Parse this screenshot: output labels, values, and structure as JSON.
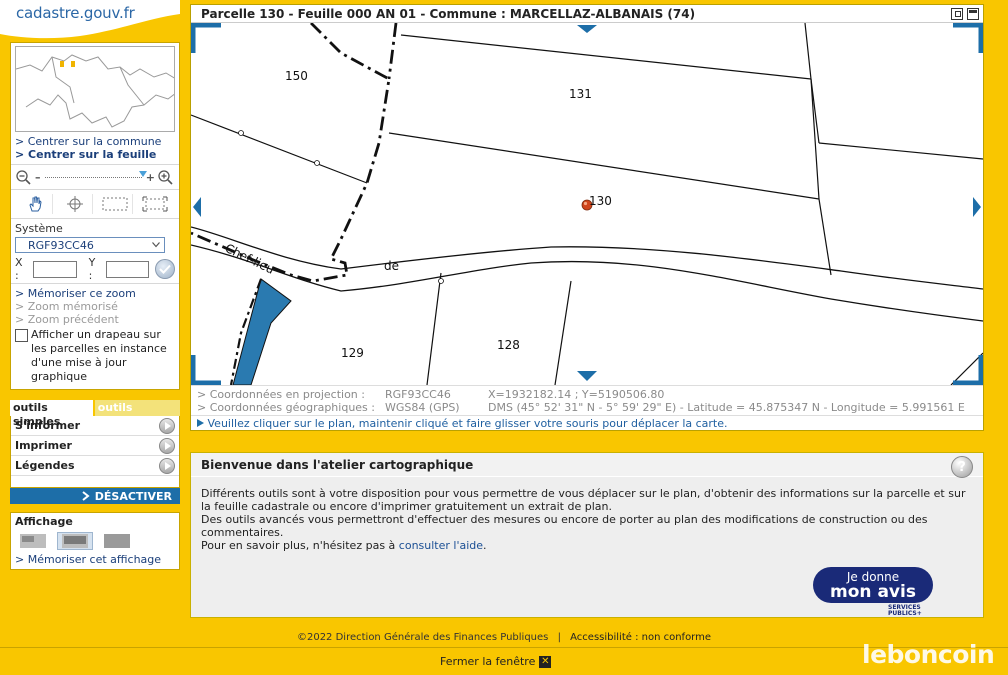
{
  "logo": {
    "text": "cadastre.gouv.fr"
  },
  "left": {
    "center_commune": "Centrer sur la commune",
    "center_feuille": "Centrer sur la feuille",
    "systeme_label": "Système",
    "systeme_value": "RGF93CC46",
    "x_label": "X :",
    "y_label": "Y :",
    "memoriser_zoom": "Mémoriser ce zoom",
    "zoom_memorise": "Zoom mémorisé",
    "zoom_precedent": "Zoom précédent",
    "flag_text": "Afficher un drapeau sur les parcelles en instance d'une mise à jour graphique",
    "tab_simple": "outils simples",
    "tab_advanced": "outils avancés",
    "tools": [
      "S'informer",
      "Imprimer",
      "Légendes"
    ],
    "deactivate": "DÉSACTIVER",
    "affichage_title": "Affichage",
    "memoriser_affichage": "Mémoriser cet affichage"
  },
  "map": {
    "title": "Parcelle 130 - Feuille 000 AN 01 - Commune : MARCELLAZ-ALBANAIS (74)",
    "parcels": [
      "150",
      "131",
      "130",
      "129",
      "128"
    ],
    "street_words": [
      "Chef-lieu",
      "de"
    ],
    "coords": {
      "proj_label": "> Coordonnées en projection :",
      "proj_system": "RGF93CC46",
      "proj_value": "X=1932182.14 ; Y=5190506.80",
      "geo_label": "> Coordonnées géographiques :",
      "geo_system": "WGS84 (GPS)",
      "geo_value": "DMS (45° 52' 31\" N - 5° 59' 29\" E) - Latitude = 45.875347 N - Longitude = 5.991561 E"
    },
    "hint": "Veuillez cliquer sur le plan, maintenir cliqué et faire glisser votre souris pour déplacer la carte."
  },
  "welcome": {
    "title": "Bienvenue dans l'atelier cartographique",
    "p1": "Différents outils sont à votre disposition pour vous permettre de vous déplacer sur le plan, d'obtenir des informations sur la parcelle et sur la feuille cadastrale ou encore d'imprimer gratuitement un extrait de plan.",
    "p2": "Des outils avancés vous permettront d'effectuer des mesures ou encore de porter au plan des modifications de construction ou des commentaires.",
    "p3_prefix": "Pour en savoir plus, n'hésitez pas à",
    "p3_link": "consulter l'aide",
    "p3_suffix": ".",
    "avis_l1": "Je donne",
    "avis_l2": "mon avis",
    "sp_l1": "SERVICES",
    "sp_l2": "PUBLICS+"
  },
  "footer": {
    "copyright": "©2022 Direction Générale des Finances Publiques",
    "divider": "|",
    "accessibility": "Accessibilité : non conforme",
    "close": "Fermer la fenêtre",
    "close_glyph": "✕"
  },
  "watermark": "leboncoin",
  "colors": {
    "background": "#f9c600",
    "link": "#1b3f7a",
    "accent_blue": "#1d6ea8",
    "parcel_fill": "#2a7ab0"
  }
}
